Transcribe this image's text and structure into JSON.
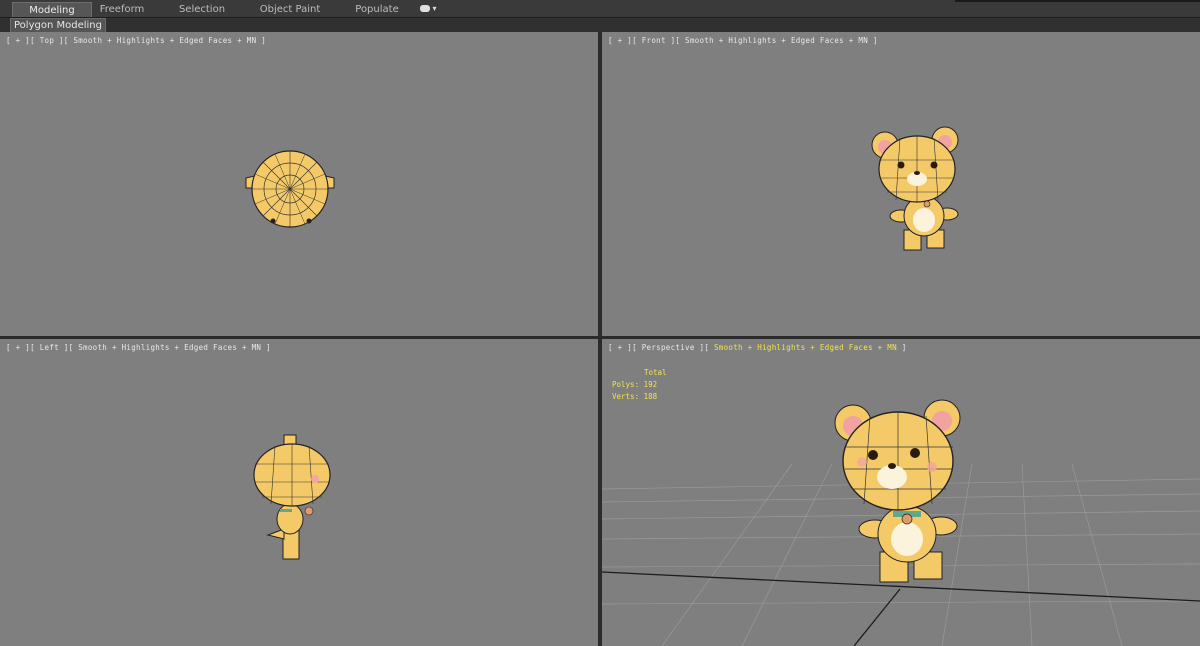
{
  "ribbon": {
    "tabs": [
      {
        "label": "Modeling",
        "active": true
      },
      {
        "label": "Freeform",
        "active": false
      },
      {
        "label": "Selection",
        "active": false
      },
      {
        "label": "Object Paint",
        "active": false
      },
      {
        "label": "Populate",
        "active": false
      }
    ],
    "dropdown_arrow": "▾"
  },
  "panel": {
    "label": "Polygon Modeling"
  },
  "viewports": {
    "top": {
      "label": "[ + ][ Top ][ Smooth + Highlights + Edged Faces + MN ]"
    },
    "front": {
      "label": "[ + ][ Front ][ Smooth + Highlights + Edged Faces + MN ]"
    },
    "left": {
      "label": "[ + ][ Left ][ Smooth + Highlights + Edged Faces + MN ]"
    },
    "perspective": {
      "label_prefix": "[ + ][ Perspective ][ ",
      "label_highlight": "Smooth + Highlights + Edged Faces + MN",
      "label_suffix": " ]"
    }
  },
  "stats": {
    "header": "Total",
    "polys": "Polys: 192",
    "verts": "Verts: 188"
  },
  "colors": {
    "viewport_bg": "#7f7f7f",
    "model_fill": "#f4c968",
    "highlight_text": "#f2e34c"
  }
}
